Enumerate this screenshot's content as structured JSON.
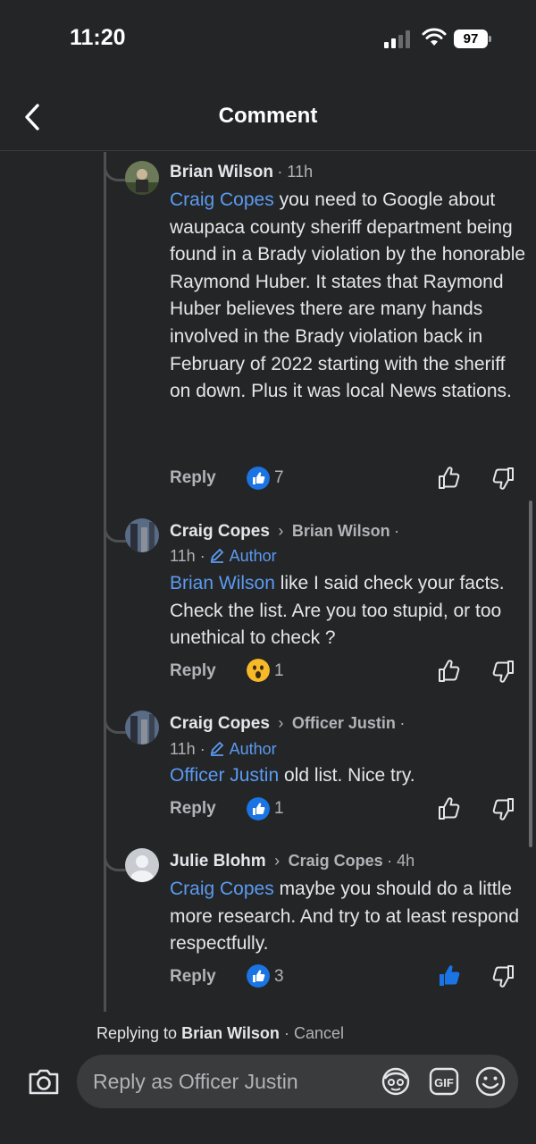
{
  "status_bar": {
    "time": "11:20",
    "battery": "97"
  },
  "header": {
    "title": "Comment"
  },
  "comments": [
    {
      "author": "Brian Wilson",
      "meta": "· 11h",
      "mention": "Craig Copes",
      "text": " you need to Google about waupaca county sheriff department being found in a Brady violation by the honorable Raymond Huber. It states that Raymond Huber believes there are many hands involved in the Brady violation back in February of 2022 starting with the sheriff on down. Plus it was local News stations.",
      "reply_label": "Reply",
      "reaction": "like",
      "reaction_count": "7"
    },
    {
      "author": "Craig Copes",
      "reply_to": "Brian Wilson",
      "meta_suffix": "·",
      "time": "11h ·",
      "author_tag": "Author",
      "mention": "Brian Wilson",
      "text": " like I said check your facts. Check the list. Are you too stupid, or too unethical to check ?",
      "reply_label": "Reply",
      "reaction": "wow",
      "reaction_count": "1"
    },
    {
      "author": "Craig Copes",
      "reply_to": "Officer Justin",
      "meta_suffix": "·",
      "time": "11h ·",
      "author_tag": "Author",
      "mention": "Officer Justin",
      "text": " old list. Nice try.",
      "reply_label": "Reply",
      "reaction": "like",
      "reaction_count": "1"
    },
    {
      "author": "Julie Blohm",
      "reply_to": "Craig Copes",
      "meta_suffix": "· 4h",
      "mention": "Craig Copes",
      "text": " maybe you should do a little more research.  And try to at least respond respectfully.",
      "reply_label": "Reply",
      "reaction": "like",
      "reaction_count": "3",
      "liked_by_viewer": true
    }
  ],
  "composer": {
    "replying_prefix": "Replying to",
    "replying_name": "Brian Wilson",
    "cancel_label": "· Cancel",
    "placeholder": "Reply as Officer Justin",
    "icons": [
      "camera-icon",
      "avatar-sticker-icon",
      "gif-icon",
      "emoji-icon"
    ]
  },
  "colors": {
    "background": "#242526",
    "accent": "#5b9bf2",
    "like_blue": "#1b74e4"
  }
}
